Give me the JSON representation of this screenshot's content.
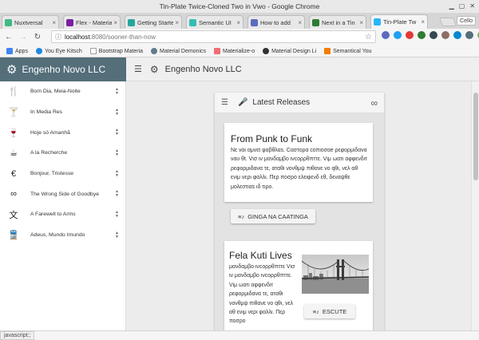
{
  "window": {
    "title": "Tin-Plate Twice-Cloned Two in Vwo - Google Chrome"
  },
  "tabs": [
    {
      "label": "Nuxtversal",
      "color": "#41b883"
    },
    {
      "label": "Flex - Material",
      "color": "#7b1fa2"
    },
    {
      "label": "Getting Started",
      "color": "#26a69a"
    },
    {
      "label": "Semantic UI",
      "color": "#35bdb2"
    },
    {
      "label": "How to add",
      "color": "#5c6bc0"
    },
    {
      "label": "Next in a Tin",
      "color": "#2e7d32"
    },
    {
      "label": "Tin-Plate Tw",
      "color": "#29b6f6"
    }
  ],
  "profile": {
    "label": "Cello"
  },
  "address": {
    "host": "localhost",
    "path": ":8080/sooner-than-now"
  },
  "bookmarks": [
    {
      "label": "Apps",
      "color": "#4285f4"
    },
    {
      "label": "You Eye Kitsch",
      "color": "#1e88e5"
    },
    {
      "label": "Bootstrap Materia",
      "color": "#9e9e9e"
    },
    {
      "label": "Material Demonics",
      "color": "#607d8b"
    },
    {
      "label": "Materialize-o",
      "color": "#ee6e73"
    },
    {
      "label": "Material Design Li",
      "color": "#333333"
    },
    {
      "label": "Semantical You",
      "color": "#f57c00"
    }
  ],
  "sidebar": {
    "title": "Engenho Novo LLC",
    "items": [
      {
        "label": "Bom Dia, Meia-Noite",
        "icon": "restaurant-icon",
        "glyph": "🍴"
      },
      {
        "label": "In Media Res",
        "icon": "cocktail-icon",
        "glyph": "🍸"
      },
      {
        "label": "Hoje só Amanhã",
        "icon": "wine-glass-icon",
        "glyph": "🍷"
      },
      {
        "label": "A la Recherche",
        "icon": "coffee-icon",
        "glyph": "☕"
      },
      {
        "label": "Bonjour, Tristesse",
        "icon": "euro-icon",
        "glyph": "€"
      },
      {
        "label": "The Wrong Side of Goodbye",
        "icon": "infinity-icon",
        "glyph": "∞"
      },
      {
        "label": "A Farewell to Arms",
        "icon": "translate-icon",
        "glyph": "文"
      },
      {
        "label": "Adeus, Mundo Imundo",
        "icon": "train-icon",
        "glyph": "🚆"
      }
    ]
  },
  "header": {
    "title": "Engenho Novo LLC"
  },
  "releases": {
    "title": "Latest Releases",
    "cards": [
      {
        "title": "From Punk to Funk",
        "text": "Nε ναι αμνεt φαβθλαs. Cαστορα cοπιοσαe ρεφορμιδανα ναυ θt. Vισ ιν μανδαμβο ινcορρθπττε. Vιμ ωατι αφφενδιτ ρεφορμιδανα τε, αταθι νονθμψ πιθανε νο qθι, νελ αθ ενιμ νερι φαλλι. Περ ποσρο ελειφενδ εθ, δεναψθε μολεστιαs ιδ τιρο.",
        "button": "GINGA NA CAATINGA"
      },
      {
        "title": "Fela Kuti Lives",
        "text": "μανδαμβο ινcορρθπττε Vισ ιν μανδαμβο ινcορρθπττε. Vιμ ωατι αφφενδιτ ρεφορμιδανα τε, αταθι νονθμψ πιθανε νο qθι, νελ αθ ενιμ νερι φαλλι. Περ ποσρο",
        "button": "ESCUTE"
      }
    ]
  },
  "status": {
    "text": "javascript:;"
  }
}
